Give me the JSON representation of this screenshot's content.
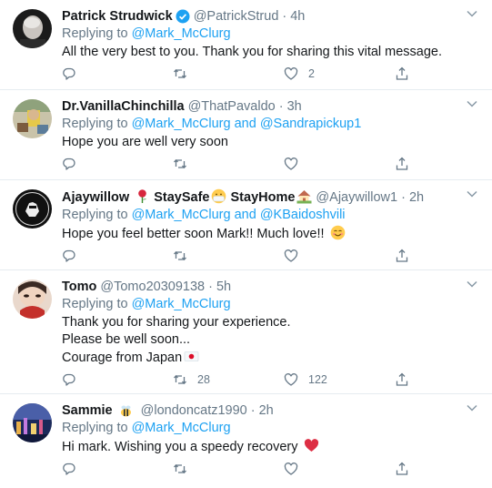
{
  "colors": {
    "accent": "#1da1f2",
    "muted": "#657786",
    "text": "#14171a",
    "heart": "#e0245e"
  },
  "tweets": [
    {
      "name": "Patrick Strudwick",
      "verified": true,
      "handle": "@PatrickStrud",
      "time": "4h",
      "replying_prefix": "Replying to",
      "mentions": [
        "@Mark_McClurg"
      ],
      "mention_joiner": "",
      "body": [
        "All the very best to you. Thank you for sharing this vital message."
      ],
      "reply_count": "",
      "retweet_count": "",
      "like_count": "2"
    },
    {
      "name": "Dr.VanillaChinchilla",
      "verified": false,
      "handle": "@ThatPavaldo",
      "time": "3h",
      "replying_prefix": "Replying to",
      "mentions": [
        "@Mark_McClurg",
        "@Sandrapickup1"
      ],
      "mention_joiner": "and",
      "body": [
        "Hope you are well very soon"
      ],
      "reply_count": "",
      "retweet_count": "",
      "like_count": ""
    },
    {
      "name_parts": [
        "Ajaywillow",
        "StaySafe",
        "StayHome"
      ],
      "verified": false,
      "handle": "@Ajaywillow1",
      "time": "2h",
      "replying_prefix": "Replying to",
      "mentions": [
        "@Mark_McClurg",
        "@KBaidoshvili"
      ],
      "mention_joiner": "and",
      "body": [
        "Hope you feel better soon Mark!! Much love!!"
      ],
      "reply_count": "",
      "retweet_count": "",
      "like_count": ""
    },
    {
      "name": "Tomo",
      "verified": false,
      "handle": "@Tomo20309138",
      "time": "5h",
      "replying_prefix": "Replying to",
      "mentions": [
        "@Mark_McClurg"
      ],
      "mention_joiner": "",
      "body": [
        "Thank you for sharing your experience.",
        "Please be well soon...",
        "Courage from Japan"
      ],
      "reply_count": "",
      "retweet_count": "28",
      "like_count": "122"
    },
    {
      "name": "Sammie",
      "verified": false,
      "handle": "@londoncatz1990",
      "time": "2h",
      "replying_prefix": "Replying to",
      "mentions": [
        "@Mark_McClurg"
      ],
      "mention_joiner": "",
      "body": [
        "Hi mark. Wishing you a speedy recovery"
      ],
      "reply_count": "",
      "retweet_count": "",
      "like_count": ""
    }
  ]
}
